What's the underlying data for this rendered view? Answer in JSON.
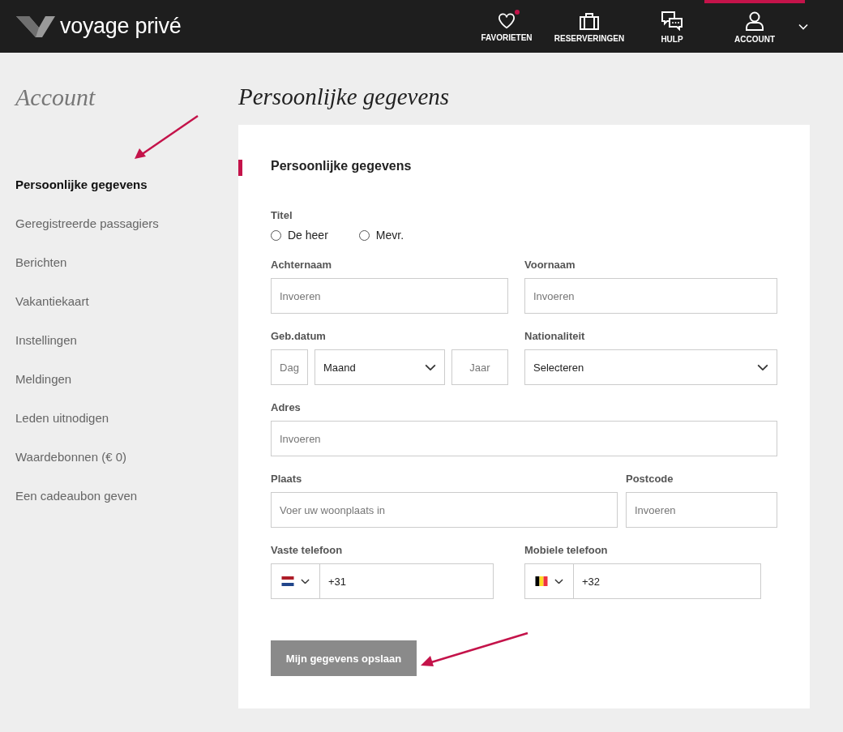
{
  "header": {
    "logo": "voyage privé",
    "nav": [
      {
        "label": "FAVORIETEN",
        "kind": "heart",
        "selected": false,
        "notification": true
      },
      {
        "label": "RESERVERINGEN",
        "kind": "suitcase",
        "selected": false,
        "notification": false
      },
      {
        "label": "HULP",
        "kind": "help",
        "selected": false,
        "notification": false
      },
      {
        "label": "ACCOUNT",
        "kind": "user",
        "selected": true,
        "notification": false
      }
    ]
  },
  "sidebar": {
    "title": "Account",
    "items": [
      {
        "label": "Persoonlijke gegevens",
        "selected": true
      },
      {
        "label": "Geregistreerde passagiers",
        "selected": false
      },
      {
        "label": "Berichten",
        "selected": false
      },
      {
        "label": "Vakantiekaart",
        "selected": false
      },
      {
        "label": "Instellingen",
        "selected": false
      },
      {
        "label": "Meldingen",
        "selected": false
      },
      {
        "label": "Leden uitnodigen",
        "selected": false
      },
      {
        "label": "Waardebonnen (€ 0)",
        "selected": false
      },
      {
        "label": "Een cadeaubon geven",
        "selected": false
      }
    ]
  },
  "page_title": "Persoonlijke gegevens",
  "form": {
    "section_title": "Persoonlijke gegevens",
    "title_group": {
      "label": "Titel",
      "options": [
        {
          "label": "De heer",
          "selected": false
        },
        {
          "label": "Mevr.",
          "selected": false
        }
      ]
    },
    "rows": [
      [
        {
          "label": "Achternaam",
          "controls": [
            {
              "kind": "text",
              "placeholder": "Invoeren"
            }
          ]
        },
        {
          "label": "Voornaam",
          "controls": [
            {
              "kind": "text",
              "placeholder": "Invoeren"
            }
          ]
        }
      ],
      [
        {
          "label": "Geb.datum",
          "controls": [
            {
              "kind": "small",
              "placeholder": "Dag"
            },
            {
              "kind": "select",
              "value": "Maand"
            },
            {
              "kind": "small",
              "placeholder": "Jaar"
            }
          ]
        },
        {
          "label": "Nationaliteit",
          "controls": [
            {
              "kind": "select",
              "value": "Selecteren"
            }
          ]
        }
      ],
      [
        {
          "label": "Adres",
          "controls": [
            {
              "kind": "text",
              "placeholder": "Invoeren"
            }
          ]
        }
      ],
      [
        {
          "label": "Plaats",
          "controls": [
            {
              "kind": "text",
              "placeholder": "Voer uw woonplaats in"
            }
          ]
        },
        {
          "label": "Postcode",
          "controls": [
            {
              "kind": "text",
              "placeholder": "Invoeren"
            }
          ]
        }
      ],
      [
        {
          "label": "Vaste telefoon",
          "controls": [
            {
              "kind": "phone",
              "flag": {
                "kind": "horizontal",
                "stripes": [
                  {
                    "color": "#ae1c28"
                  },
                  {
                    "color": "#ffffff"
                  },
                  {
                    "color": "#21468b"
                  }
                ]
              },
              "value": "+31"
            }
          ]
        },
        {
          "label": "Mobiele telefoon",
          "controls": [
            {
              "kind": "phone",
              "flag": {
                "kind": "vertical",
                "stripes": [
                  {
                    "color": "#000000"
                  },
                  {
                    "color": "#fdda24"
                  },
                  {
                    "color": "#ef3340"
                  }
                ]
              },
              "value": "+32"
            }
          ]
        }
      ]
    ],
    "submit": "Mijn gegevens opslaan"
  }
}
